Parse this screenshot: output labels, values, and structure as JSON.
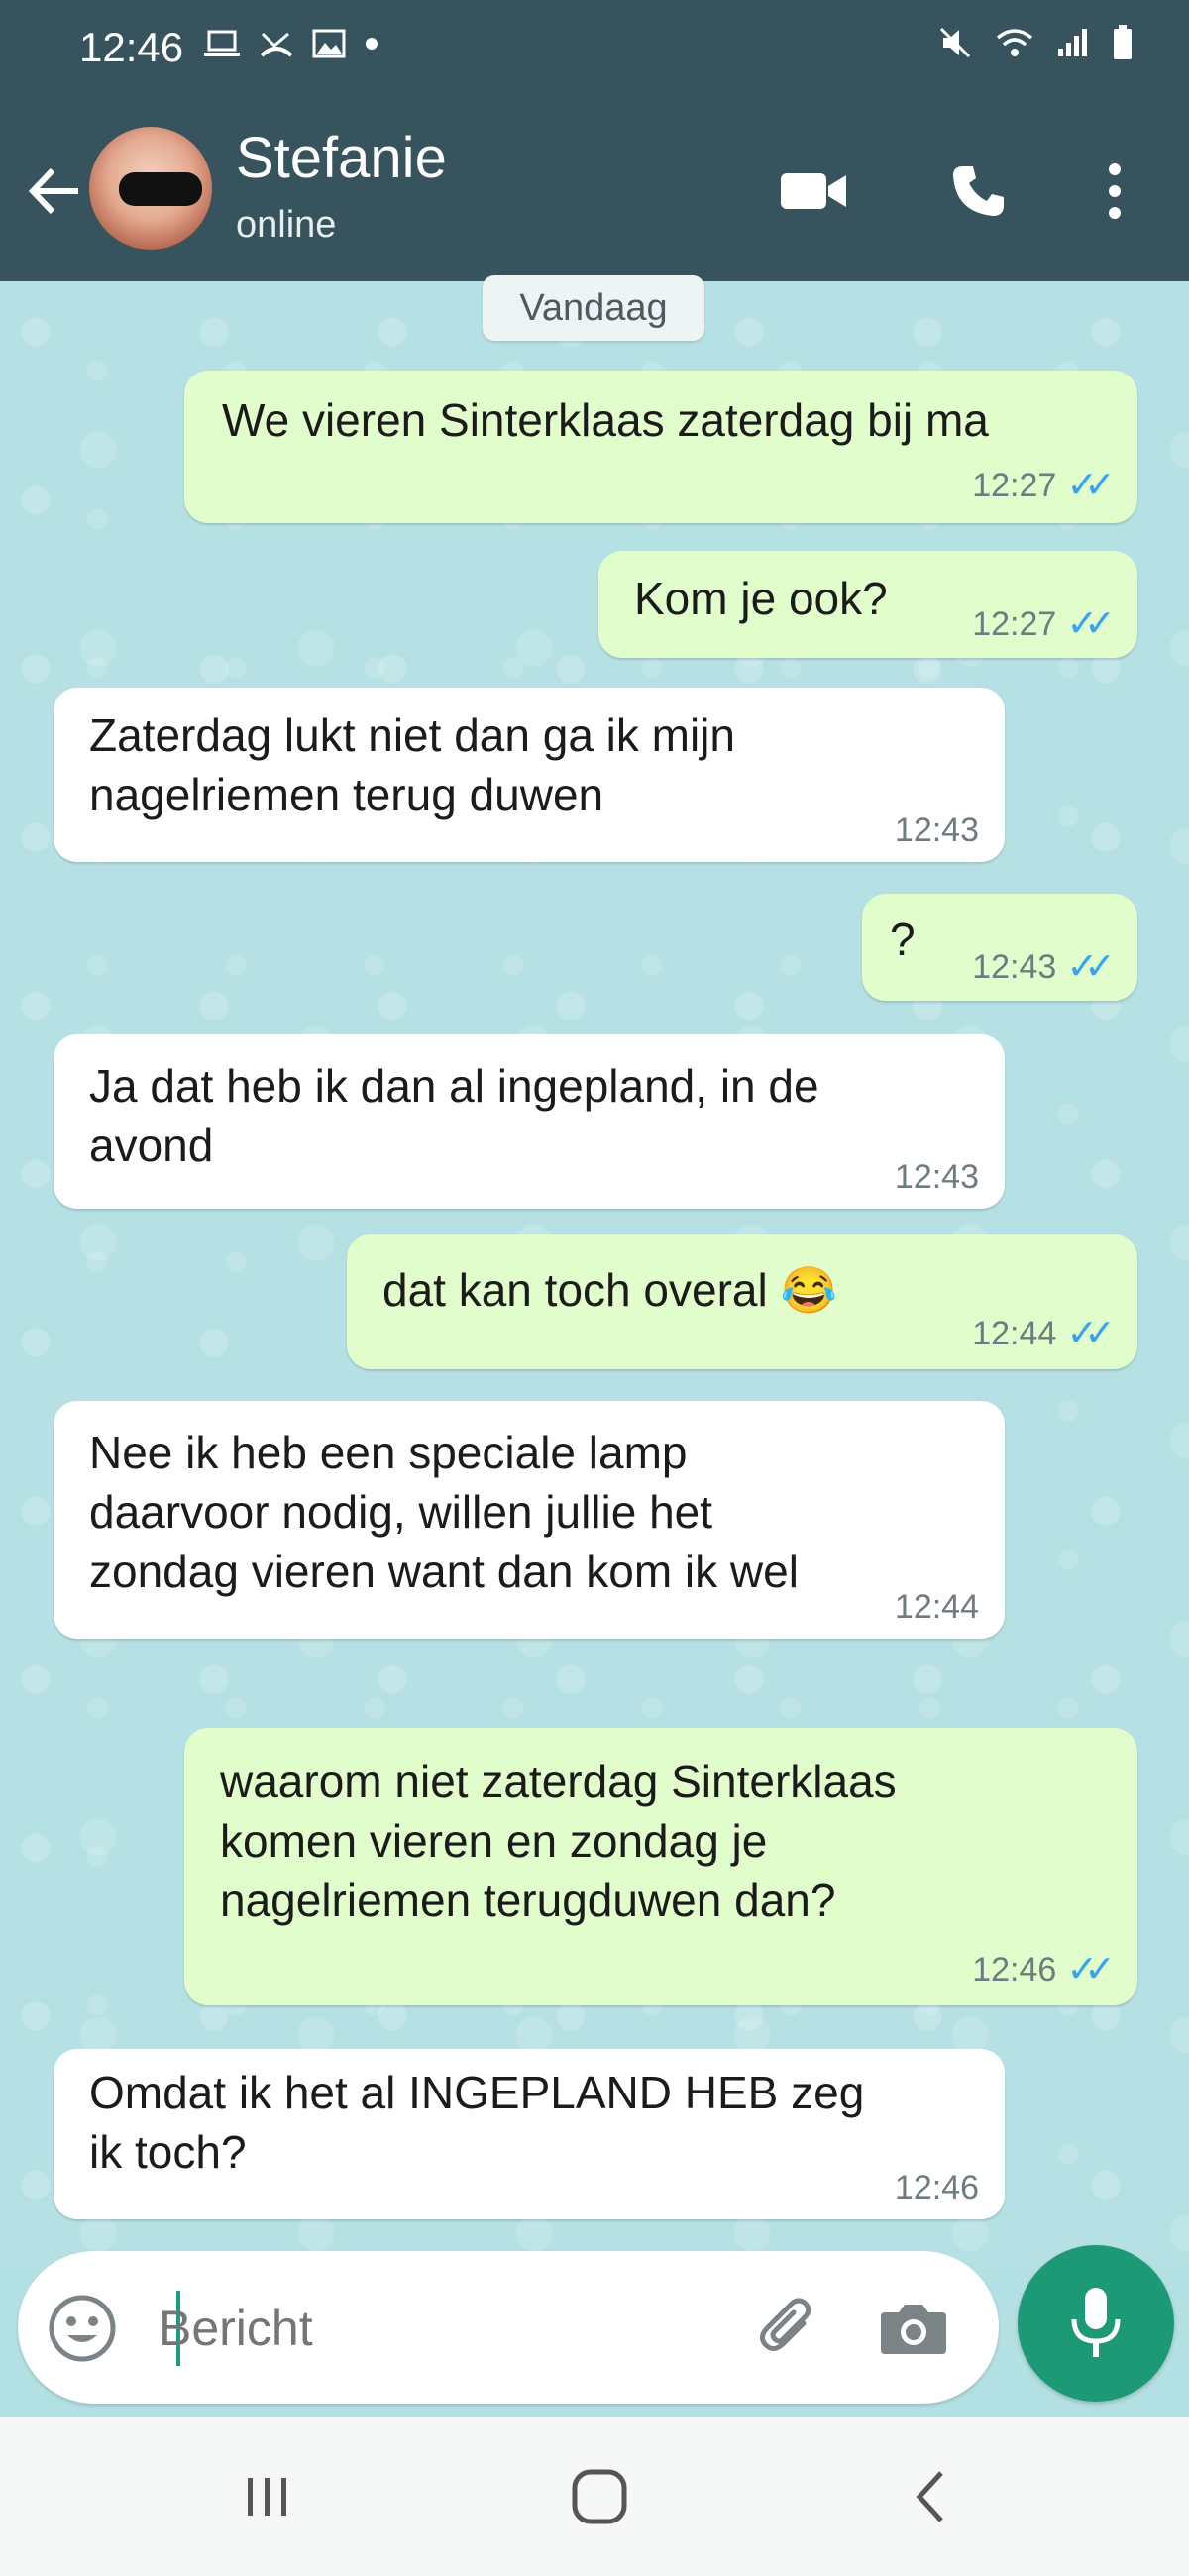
{
  "status_bar": {
    "time": "12:46",
    "icons": [
      "laptop-icon",
      "missed-call-icon",
      "image-icon",
      "dot-icon",
      "mute-icon",
      "wifi-icon",
      "signal-icon",
      "battery-icon"
    ]
  },
  "header": {
    "contact_name": "Stefanie",
    "contact_status": "online",
    "icons": [
      "back-arrow-icon",
      "video-call-icon",
      "phone-icon",
      "more-icon"
    ]
  },
  "chat": {
    "date_divider": "Vandaag",
    "messages": [
      {
        "direction": "outgoing",
        "text": "We vieren Sinterklaas zaterdag bij ma",
        "time": "12:27",
        "status": "read"
      },
      {
        "direction": "outgoing",
        "text": "Kom je ook?",
        "time": "12:27",
        "status": "read"
      },
      {
        "direction": "incoming",
        "text": "Zaterdag lukt niet dan ga ik mijn\nnagelriemen terug duwen",
        "time": "12:43"
      },
      {
        "direction": "outgoing",
        "text": "?",
        "time": "12:43",
        "status": "read"
      },
      {
        "direction": "incoming",
        "text": "Ja dat heb ik dan al ingepland, in de\navond",
        "time": "12:43"
      },
      {
        "direction": "outgoing",
        "text": "dat kan toch overal 😂",
        "time": "12:44",
        "status": "read"
      },
      {
        "direction": "incoming",
        "text": "Nee ik heb een speciale lamp\ndaarvoor nodig, willen jullie het\nzondag vieren want dan kom ik wel",
        "time": "12:44"
      },
      {
        "direction": "outgoing",
        "text": "waarom niet zaterdag Sinterklaas\nkomen vieren en zondag je\nnagelriemen terugduwen dan?",
        "time": "12:46",
        "status": "read"
      },
      {
        "direction": "incoming",
        "text": "Omdat ik het al INGEPLAND HEB zeg\nik toch?",
        "time": "12:46"
      }
    ]
  },
  "composer": {
    "placeholder": "Bericht",
    "icons": [
      "emoji-icon",
      "attach-icon",
      "camera-icon",
      "mic-icon"
    ]
  },
  "nav_bar": {
    "icons": [
      "recent-apps-icon",
      "home-icon",
      "back-icon"
    ]
  },
  "colors": {
    "header": "#37535d",
    "outgoing_bubble": "#e2fdcc",
    "incoming_bubble": "#ffffff",
    "read_ticks": "#38a3f0",
    "mic_button": "#1d9975",
    "chat_background": "#b6e1e4"
  }
}
